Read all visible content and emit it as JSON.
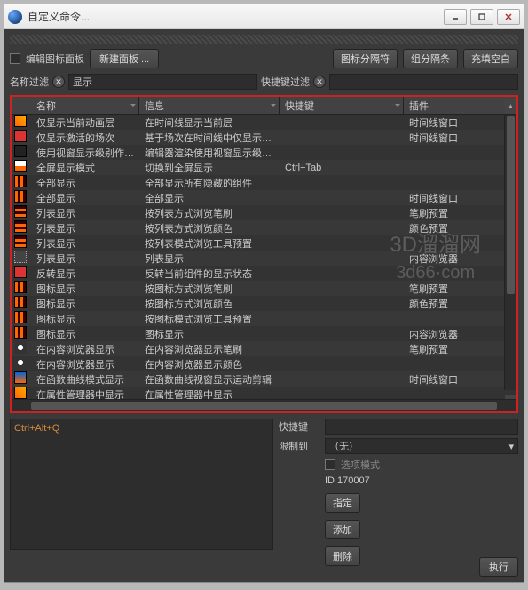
{
  "window": {
    "title": "自定义命令..."
  },
  "toolbar": {
    "edit_palette": "编辑图标面板",
    "new_palette": "新建面板 ...",
    "icon_sep": "图标分隔符",
    "group_sep": "组分隔条",
    "fill_blank": "充填空白"
  },
  "filters": {
    "name_label": "名称过滤",
    "name_value": "显示",
    "key_label": "快捷键过滤",
    "key_value": ""
  },
  "columns": {
    "name": "名称",
    "info": "信息",
    "key": "快捷键",
    "plugin": "插件"
  },
  "rows": [
    {
      "icon": "ic-a",
      "name": "仅显示当前动画层",
      "info": "在时间线显示当前层",
      "key": "",
      "plugin": "时间线窗口"
    },
    {
      "icon": "ic-b",
      "name": "仅显示激活的场次",
      "info": "基于场次在时间线中仅显示激活",
      "key": "",
      "plugin": "时间线窗口"
    },
    {
      "icon": "ic-c",
      "name": "使用视窗显示级别作为渲",
      "info": "编辑器渲染使用视窗显示级别作",
      "key": "",
      "plugin": ""
    },
    {
      "icon": "ic-d",
      "name": "全屏显示模式",
      "info": "切换到全屏显示",
      "key": "Ctrl+Tab",
      "plugin": ""
    },
    {
      "icon": "ic-e",
      "name": "全部显示",
      "info": "全部显示所有隐藏的组件",
      "key": "",
      "plugin": ""
    },
    {
      "icon": "ic-e",
      "name": "全部显示",
      "info": "全部显示",
      "key": "",
      "plugin": "时间线窗口"
    },
    {
      "icon": "ic-f",
      "name": "列表显示",
      "info": "按列表方式浏览笔刷",
      "key": "",
      "plugin": "笔刷预置"
    },
    {
      "icon": "ic-f",
      "name": "列表显示",
      "info": "按列表方式浏览颜色",
      "key": "",
      "plugin": "颜色预置"
    },
    {
      "icon": "ic-f",
      "name": "列表显示",
      "info": "按列表模式浏览工具预置",
      "key": "",
      "plugin": ""
    },
    {
      "icon": "ic-g",
      "name": "列表显示",
      "info": "列表显示",
      "key": "",
      "plugin": "内容浏览器"
    },
    {
      "icon": "ic-b",
      "name": "反转显示",
      "info": "反转当前组件的显示状态",
      "key": "",
      "plugin": ""
    },
    {
      "icon": "ic-e",
      "name": "图标显示",
      "info": "按图标方式浏览笔刷",
      "key": "",
      "plugin": "笔刷预置"
    },
    {
      "icon": "ic-e",
      "name": "图标显示",
      "info": "按图标方式浏览颜色",
      "key": "",
      "plugin": "颜色预置"
    },
    {
      "icon": "ic-e",
      "name": "图标显示",
      "info": "按图标模式浏览工具预置",
      "key": "",
      "plugin": ""
    },
    {
      "icon": "ic-e",
      "name": "图标显示",
      "info": "图标显示",
      "key": "",
      "plugin": "内容浏览器"
    },
    {
      "icon": "ic-h",
      "name": "在内容浏览器显示",
      "info": "在内容浏览器显示笔刷",
      "key": "",
      "plugin": "笔刷预置"
    },
    {
      "icon": "ic-h",
      "name": "在内容浏览器显示",
      "info": "在内容浏览器显示颜色",
      "key": "",
      "plugin": ""
    },
    {
      "icon": "ic-i",
      "name": "在函数曲线模式显示",
      "info": "在函数曲线视窗显示运动剪辑",
      "key": "",
      "plugin": "时间线窗口"
    },
    {
      "icon": "ic-a",
      "name": "在属性管理器中显示",
      "info": "在属性管理器中显示",
      "key": "",
      "plugin": ""
    }
  ],
  "watermark": {
    "line1": "3D溜溜网",
    "line2": "3d66·com"
  },
  "detail": {
    "shortcut_text": "Ctrl+Alt+Q",
    "key_label": "快捷键",
    "key_value": "",
    "restrict_label": "限制到",
    "restrict_value": "（无）",
    "option_mode": "选项模式",
    "id_label": "ID 170007",
    "assign": "指定",
    "add": "添加",
    "delete": "删除"
  },
  "footer": {
    "execute": "执行"
  }
}
